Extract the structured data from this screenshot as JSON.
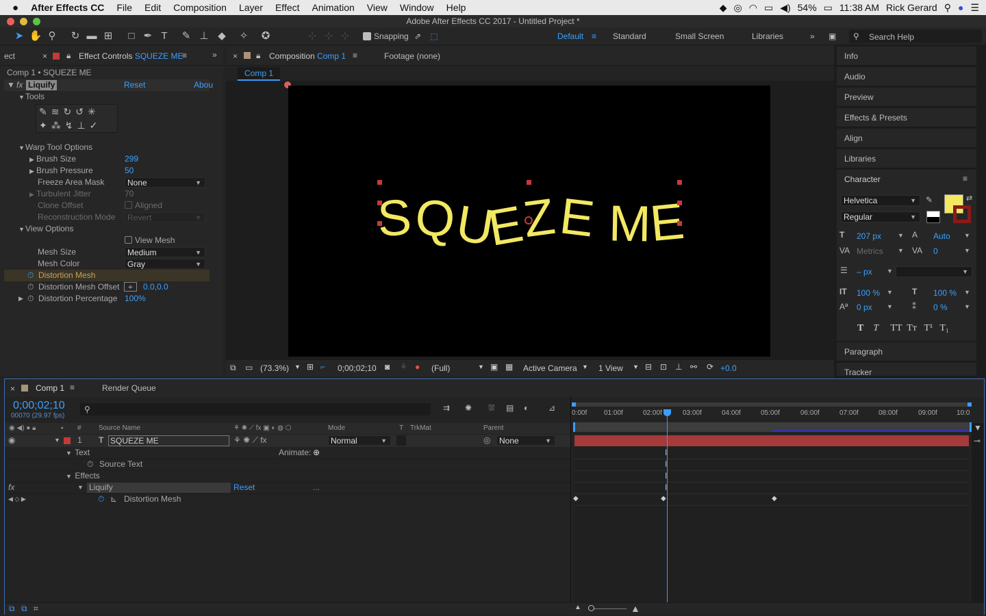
{
  "menubar": {
    "app": "After Effects CC",
    "items": [
      "File",
      "Edit",
      "Composition",
      "Layer",
      "Effect",
      "Animation",
      "View",
      "Window",
      "Help"
    ],
    "battery": "54%",
    "time": "11:38 AM",
    "user": "Rick Gerard"
  },
  "window": {
    "title": "Adobe After Effects CC 2017 - Untitled Project *"
  },
  "toolbar": {
    "snapping": "Snapping",
    "workspaces": [
      "Default",
      "Standard",
      "Small Screen",
      "Libraries"
    ],
    "search_placeholder": "Search Help"
  },
  "effect_controls": {
    "left_tab": "ect",
    "tab_prefix": "Effect Controls",
    "tab_layer": "SQUEZE ME",
    "breadcrumb": "Comp 1 • SQUEZE ME",
    "effect_name": "Liquify",
    "reset": "Reset",
    "about": "Abou",
    "tools_label": "Tools",
    "warp_options": "Warp Tool Options",
    "brush_size_label": "Brush Size",
    "brush_size": "299",
    "brush_pressure_label": "Brush Pressure",
    "brush_pressure": "50",
    "freeze_label": "Freeze Area Mask",
    "freeze_value": "None",
    "turbulent_label": "Turbulent Jitter",
    "turbulent_value": "70",
    "clone_label": "Clone Offset",
    "clone_value": "Aligned",
    "recon_label": "Reconstruction Mode",
    "recon_value": "Revert",
    "view_options": "View Options",
    "view_mesh": "View Mesh",
    "mesh_size_label": "Mesh Size",
    "mesh_size": "Medium",
    "mesh_color_label": "Mesh Color",
    "mesh_color": "Gray",
    "distortion_mesh": "Distortion Mesh",
    "dmo_label": "Distortion Mesh Offset",
    "dmo_value": "0.0,0.0",
    "dp_label": "Distortion Percentage",
    "dp_value": "100%"
  },
  "composition": {
    "tab_prefix": "Composition",
    "tab_comp": "Comp 1",
    "footage": "Footage (none)",
    "subtab": "Comp 1",
    "text": "SQUEZE ME",
    "text_color": "#f2e862",
    "zoom": "(73.3%)",
    "timecode": "0;00;02;10",
    "resolution": "(Full)",
    "camera": "Active Camera",
    "views": "1 View",
    "exposure": "+0.0"
  },
  "right_panels": [
    "Info",
    "Audio",
    "Preview",
    "Effects & Presets",
    "Align",
    "Libraries"
  ],
  "character": {
    "title": "Character",
    "font": "Helvetica",
    "style": "Regular",
    "size": "207 px",
    "leading": "Auto",
    "kerning": "Metrics",
    "tracking": "0",
    "stroke": "– px",
    "vscale": "100 %",
    "hscale": "100 %",
    "baseline": "0 px",
    "tsume": "0 %",
    "fill_color": "#f2e862",
    "paragraph": "Paragraph",
    "tracker": "Tracker"
  },
  "timeline": {
    "tab": "Comp 1",
    "render_queue": "Render Queue",
    "timecode": "0;00;02;10",
    "frames": "00070 (29.97 fps)",
    "col_source": "Source Name",
    "col_mode": "Mode",
    "col_trkmat": "TrkMat",
    "col_parent": "Parent",
    "layer_num": "1",
    "layer_name": "SQUEZE ME",
    "layer_mode": "Normal",
    "layer_parent": "None",
    "text_group": "Text",
    "animate": "Animate:",
    "source_text": "Source Text",
    "effects": "Effects",
    "liquify": "Liquify",
    "reset": "Reset",
    "dots": "...",
    "distortion_mesh": "Distortion Mesh",
    "ruler": [
      "0:00f",
      "01:00f",
      "02:00f",
      "03:00f",
      "04:00f",
      "05:00f",
      "06:00f",
      "07:00f",
      "08:00f",
      "09:00f",
      "10:0"
    ],
    "bar_color": "#a43a3a"
  }
}
